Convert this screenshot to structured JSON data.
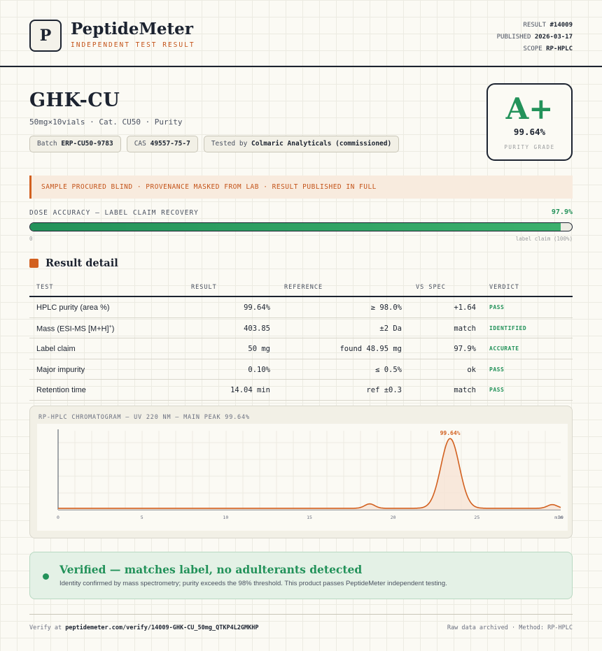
{
  "header": {
    "logo_letter": "P",
    "brand": "PeptideMeter",
    "subtitle": "INDEPENDENT TEST RESULT",
    "result_label": "RESULT",
    "result_id": "#14009",
    "published_label": "PUBLISHED",
    "published_date": "2026-03-17",
    "scope_label": "SCOPE",
    "scope_value": "RP-HPLC"
  },
  "product": {
    "name": "GHK-CU",
    "subline": "50mg×10vials · Cat. CU50 · Purity",
    "batch_label": "Batch",
    "batch_value": "ERP-CU50-9783",
    "cas_label": "CAS",
    "cas_value": "49557-75-7",
    "tested_label": "Tested by",
    "tested_value": "Colmaric Analyticals (commissioned)"
  },
  "grade": {
    "letter": "A+",
    "percent": "99.64%",
    "label": "PURITY GRADE",
    "color": "#23925a"
  },
  "banner": {
    "text": "SAMPLE PROCURED BLIND · PROVENANCE MASKED FROM LAB · RESULT PUBLISHED IN FULL"
  },
  "dose": {
    "label": "DOSE ACCURACY — LABEL CLAIM RECOVERY",
    "value_text": "97.9%",
    "fraction": 0.979,
    "min_label": "0",
    "max_label": "label claim (100%)"
  },
  "section": {
    "title": "Result detail"
  },
  "table": {
    "headers": {
      "test": "TEST",
      "result": "RESULT",
      "reference": "REFERENCE",
      "vs": "VS SPEC",
      "verdict": "VERDICT"
    },
    "rows": [
      {
        "test": "HPLC purity (area %)",
        "result": "99.64%",
        "reference": "≥ 98.0%",
        "vs": "+1.64",
        "verdict": "PASS"
      },
      {
        "test": "Mass (ESI-MS [M+H]",
        "test_sup": "+",
        "test_end": ")",
        "result": "403.85",
        "reference": "±2 Da",
        "vs": "match",
        "verdict": "IDENTIFIED"
      },
      {
        "test": "Label claim",
        "result": "50 mg",
        "reference": "found 48.95 mg",
        "vs": "97.9%",
        "verdict": "ACCURATE"
      },
      {
        "test": "Major impurity",
        "result": "0.10%",
        "reference": "≤ 0.5%",
        "vs": "ok",
        "verdict": "PASS"
      },
      {
        "test": "Retention time",
        "result": "14.04 min",
        "reference": "ref ±0.3",
        "vs": "match",
        "verdict": "PASS"
      }
    ]
  },
  "chromatogram": {
    "title": "RP-HPLC CHROMATOGRAM — UV 220 NM — MAIN PEAK 99.64%",
    "peak_label": "99.64%",
    "x_ticks": [
      "0",
      "5",
      "10",
      "15",
      "20",
      "25",
      "30"
    ],
    "x_end_label": "min",
    "line_color": "#d2601f"
  },
  "chart_data": {
    "type": "line",
    "title": "RP-HPLC CHROMATOGRAM — UV 220 NM — MAIN PEAK 99.64%",
    "xlabel": "",
    "ylabel": "",
    "x_unit": "min",
    "xlim": [
      0,
      30
    ],
    "x_ticks": [
      0,
      5,
      10,
      15,
      20,
      25,
      30
    ],
    "baseline": 0.02,
    "peaks": [
      {
        "x": 18.6,
        "height": 0.06,
        "width": 0.3
      },
      {
        "x": 23.4,
        "height": 0.95,
        "width": 0.55,
        "label": "99.64%"
      },
      {
        "x": 29.5,
        "height": 0.05,
        "width": 0.3
      }
    ]
  },
  "verified": {
    "title": "Verified — matches label, no adulterants detected",
    "description": "Identity confirmed by mass spectrometry; purity exceeds the 98% threshold. This product passes PeptideMeter independent testing."
  },
  "footer": {
    "verify_prefix": "Verify at",
    "verify_url": "peptidemeter.com/verify/14009-GHK-CU_50mg_QTKP4L2GMKHP",
    "right_text": "Raw data archived · Method: RP-HPLC"
  }
}
